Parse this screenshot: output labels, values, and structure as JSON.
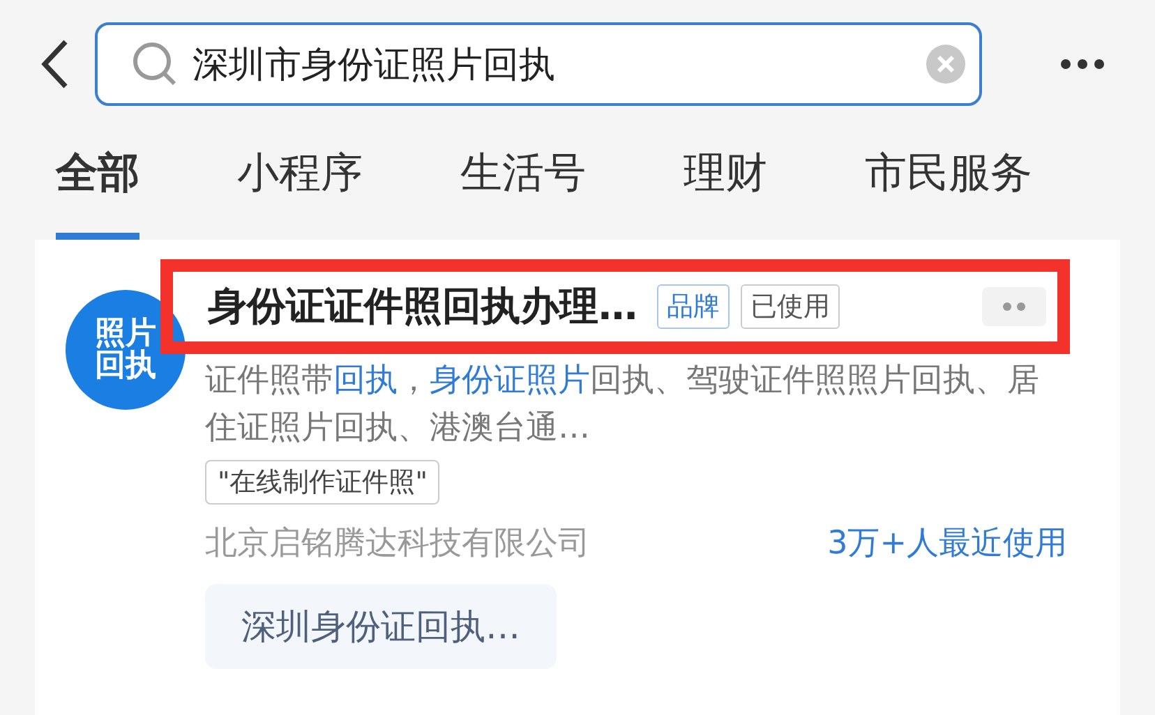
{
  "search": {
    "value": "深圳市身份证照片回执"
  },
  "tabs": [
    {
      "label": "全部",
      "selected": true
    },
    {
      "label": "小程序",
      "selected": false
    },
    {
      "label": "生活号",
      "selected": false
    },
    {
      "label": "理财",
      "selected": false
    },
    {
      "label": "市民服务",
      "selected": false
    }
  ],
  "result": {
    "logo_text": [
      "照片",
      "回执"
    ],
    "title": "身份证证件照回执办理…",
    "highlighted": true,
    "badges": [
      {
        "label": "品牌",
        "kind": "brand"
      },
      {
        "label": "已使用",
        "kind": "used"
      }
    ],
    "description": [
      {
        "text": "证件照带",
        "kind": "plain"
      },
      {
        "text": "回执",
        "kind": "match"
      },
      {
        "text": "，",
        "kind": "plain"
      },
      {
        "text": "身份证照片",
        "kind": "match"
      },
      {
        "text": "回执、驾驶证件照照片回执、居住证照片回执、港澳台通…",
        "kind": "plain"
      }
    ],
    "tag": "\"在线制作证件照\"",
    "company": "北京启铭腾达科技有限公司",
    "usage": "3万+人最近使用",
    "service": "深圳身份证回执…"
  }
}
